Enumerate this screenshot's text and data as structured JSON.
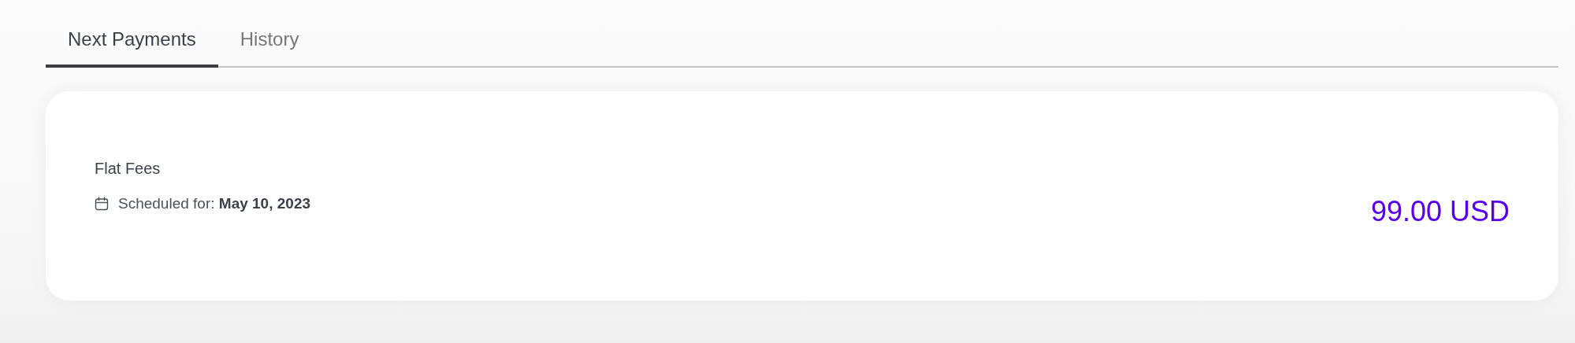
{
  "tabs": [
    {
      "label": "Next Payments",
      "selected": true
    },
    {
      "label": "History",
      "selected": false
    }
  ],
  "payments": [
    {
      "title": "Flat Fees",
      "schedule": "Scheduled for: **May 10, 2023**",
      "amount": "99.00 USD"
    }
  ]
}
